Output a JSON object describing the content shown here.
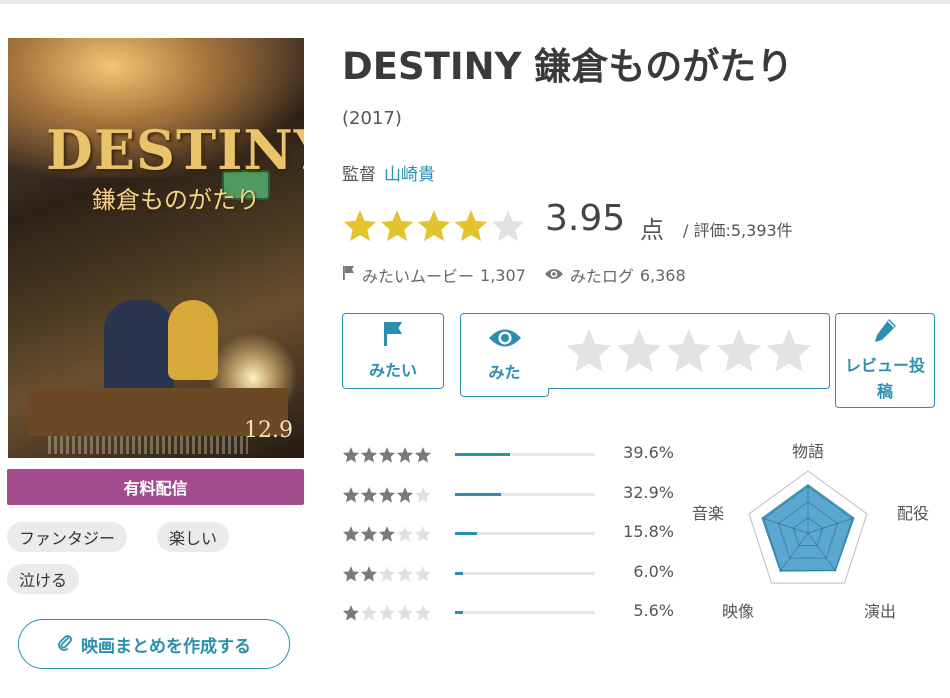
{
  "movie": {
    "title": "DESTINY 鎌倉ものがたり",
    "year": "(2017)",
    "director_label": "監督",
    "director_name": "山崎貴",
    "score": "3.95",
    "score_unit": "点",
    "rating_count": "/ 評価:5,393件",
    "average_rating": 3.95,
    "max_rating": 5
  },
  "poster": {
    "title_art": "DESTINY",
    "subtitle_art": "鎌倉ものがたり",
    "release_date": "12.9"
  },
  "stats": {
    "mitai_label": "みたいムービー",
    "mitai_count": "1,307",
    "mita_label": "みたログ",
    "mita_count": "6,368"
  },
  "actions": {
    "mitai_button": "みたい",
    "mita_button": "みた",
    "review_button": "レビュー投稿",
    "rate_stars": 5
  },
  "distribution": [
    {
      "stars": 5,
      "percent_label": "39.6%",
      "percent": 39.6
    },
    {
      "stars": 4,
      "percent_label": "32.9%",
      "percent": 32.9
    },
    {
      "stars": 3,
      "percent_label": "15.8%",
      "percent": 15.8
    },
    {
      "stars": 2,
      "percent_label": "6.0%",
      "percent": 6.0
    },
    {
      "stars": 1,
      "percent_label": "5.6%",
      "percent": 5.6
    }
  ],
  "radar": {
    "labels": [
      "物語",
      "配役",
      "演出",
      "映像",
      "音楽"
    ],
    "values": [
      0.78,
      0.78,
      0.75,
      0.76,
      0.78
    ]
  },
  "sidebar": {
    "paid_label": "有料配信",
    "tags": [
      "ファンタジー",
      "楽しい",
      "泣ける"
    ],
    "make_summary_button": "映画まとめを作成する"
  },
  "colors": {
    "accent": "#2c8fb0",
    "star_filled": "#e5c32d",
    "star_empty": "#e2e2e2",
    "paid_badge": "#a34c8e",
    "radar_fill": "#5aa8cf"
  },
  "icons": {
    "flag": "flag-icon",
    "eye": "eye-icon",
    "pencil": "pencil-icon",
    "clip": "paperclip-icon",
    "star": "star-icon"
  }
}
